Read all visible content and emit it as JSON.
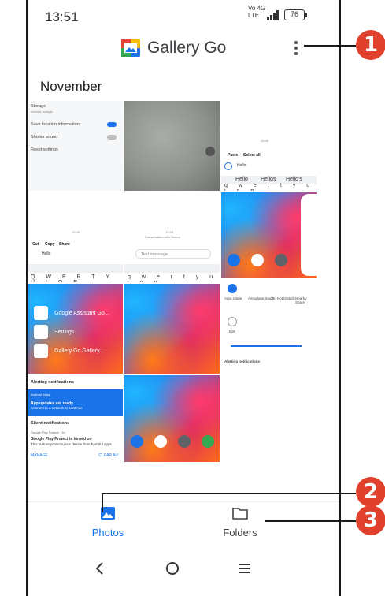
{
  "status_bar": {
    "time": "13:51",
    "network_top": "Vo  4G",
    "network_bottom": "LTE",
    "battery": "76"
  },
  "app_bar": {
    "title": "Gallery Go"
  },
  "section": {
    "month": "November"
  },
  "thumb_settings": {
    "title": "Storage",
    "subtitle": "Internal storage",
    "save_location": "Save location information",
    "shutter_sound": "Shutter sound",
    "reset": "Reset settings"
  },
  "thumb_keyboard_a": {
    "time": "13:49",
    "paste": "Paste",
    "select_all": "Select all",
    "input": "Hello",
    "suggestions": [
      "Hello",
      "Hellos",
      "Hello's"
    ],
    "keys": "q w e r t y u i o p"
  },
  "thumb_keyboard_b": {
    "time": "13:48",
    "cut": "Cut",
    "copy": "Copy",
    "share": "Share",
    "input": "Hello",
    "keys": "Q W E R T Y U I O P"
  },
  "thumb_keyboard_c": {
    "time": "13:48",
    "header": "Conversation with Gmina",
    "placeholder": "Text message",
    "keys": "q w e r t y u i o p"
  },
  "thumb_quick_settings": {
    "items": [
      "Auto-rotate",
      "Aeroplane mode",
      "Do Not Disturb",
      "Nearby Share"
    ],
    "edit": "Edit",
    "footer": "Alerting notifications"
  },
  "thumb_shortcuts": {
    "items": [
      "Google Assistant Go...",
      "Settings",
      "Gallery Go Gallery..."
    ]
  },
  "thumb_notifications": {
    "header": "Alerting notifications",
    "app_line": "Android Setup",
    "updates_title": "App updates are ready",
    "updates_body": "Connect to a network to continue",
    "silent": "Silent notifications",
    "protect_line": "Google Play Protect · 1h",
    "protect_title": "Google Play Protect is turned on",
    "protect_body": "This feature protects your device from harmful apps",
    "manage": "MANAGE",
    "clear_all": "CLEAR ALL"
  },
  "bottom_nav": {
    "photos": "Photos",
    "folders": "Folders"
  },
  "callouts": [
    "1",
    "2",
    "3"
  ],
  "colors": {
    "accent": "#1a73e8",
    "callout": "#e0402c"
  }
}
